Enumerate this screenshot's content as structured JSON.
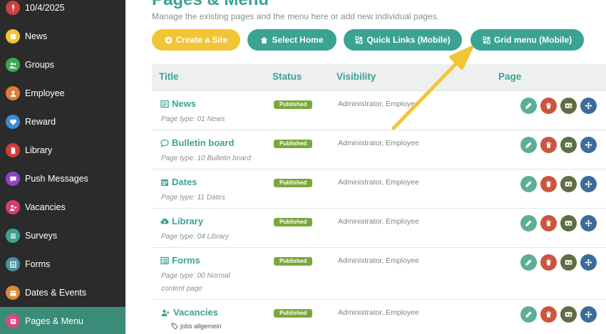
{
  "sidebar": {
    "items": [
      {
        "label": "10/4/2025",
        "icon": "pin-icon",
        "color": "#cf3f3f"
      },
      {
        "label": "News",
        "icon": "news-icon",
        "color": "#f2c534"
      },
      {
        "label": "Groups",
        "icon": "users-icon",
        "color": "#3aa857"
      },
      {
        "label": "Employee",
        "icon": "user-icon",
        "color": "#e07b3a"
      },
      {
        "label": "Reward",
        "icon": "heart-icon",
        "color": "#3d8bd4"
      },
      {
        "label": "Library",
        "icon": "file-icon",
        "color": "#d63b3b"
      },
      {
        "label": "Push Messages",
        "icon": "chat-icon",
        "color": "#8e44c9"
      },
      {
        "label": "Vacancies",
        "icon": "user-plus-icon",
        "color": "#d63b7a"
      },
      {
        "label": "Surveys",
        "icon": "list-icon",
        "color": "#3aa392"
      },
      {
        "label": "Forms",
        "icon": "form-icon",
        "color": "#4a8fa3"
      },
      {
        "label": "Dates & Events",
        "icon": "calendar-icon",
        "color": "#d68a3b"
      },
      {
        "label": "Pages & Menu",
        "icon": "pages-icon",
        "color": "#d64b7a"
      }
    ],
    "active_index": 11
  },
  "header": {
    "title": "Pages & Menu",
    "subtitle": "Manage the existing pages and the menu here or add new individual pages."
  },
  "toolbar": {
    "create_site": "Create a Site",
    "select_home": "Select Home",
    "quick_links": "Quick Links (Mobile)",
    "grid_menu": "Grid menu (Mobile)"
  },
  "table": {
    "headers": {
      "title": "Title",
      "status": "Status",
      "visibility": "Visibility",
      "page": "Page"
    },
    "rows": [
      {
        "title": "News",
        "icon": "newspaper-icon",
        "type": "Page type: 01 News",
        "status": "Published",
        "visibility": "Administrator, Employee"
      },
      {
        "title": "Bulletin board",
        "icon": "comment-icon",
        "type": "Page type: 10 Bulletin board",
        "status": "Published",
        "visibility": "Administrator, Employee"
      },
      {
        "title": "Dates",
        "icon": "calendar-icon",
        "type": "Page type: 11 Dates",
        "status": "Published",
        "visibility": "Administrator, Employee"
      },
      {
        "title": "Library",
        "icon": "cloud-download-icon",
        "type": "Page type: 04 Library",
        "status": "Published",
        "visibility": "Administrator, Employee"
      },
      {
        "title": "Forms",
        "icon": "form-list-icon",
        "type": "Page type: 00 Normal content page",
        "status": "Published",
        "visibility": "Administrator, Employee"
      },
      {
        "title": "Vacancies",
        "icon": "user-plus-icon",
        "type": "",
        "tag": "jobs allgemein",
        "status": "Published",
        "visibility": "Administrator, Employee"
      }
    ]
  },
  "colors": {
    "accent": "#3aa392",
    "sidebar_bg": "#2b2b2b",
    "sidebar_active": "#3a8c79",
    "primary_button": "#f2c534",
    "badge": "#7aa83a",
    "arrow": "#f2c534"
  }
}
